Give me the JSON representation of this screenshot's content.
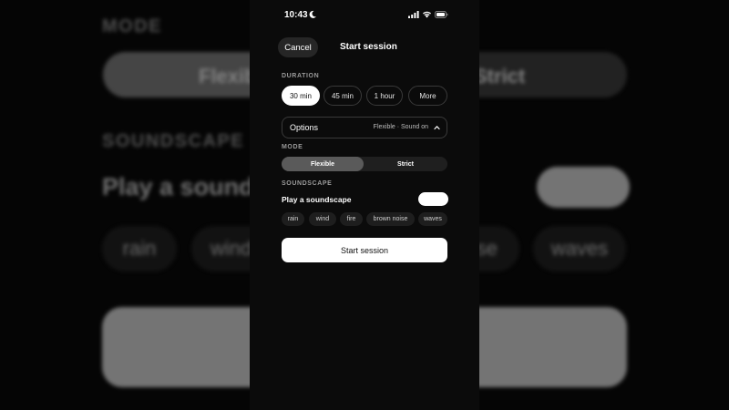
{
  "background": {
    "mode_label": "MODE",
    "mode_flexible": "Flexible",
    "mode_strict": "Strict",
    "soundscape_label": "SOUNDSCAPE",
    "play_label": "Play a sounds",
    "chips": [
      "rain",
      "wind",
      "se",
      "waves"
    ]
  },
  "status_bar": {
    "time": "10:43",
    "icons": [
      "moon-icon",
      "signal-icon",
      "wifi-icon",
      "battery-icon"
    ]
  },
  "nav": {
    "cancel_label": "Cancel",
    "title": "Start session"
  },
  "duration": {
    "label": "DURATION",
    "options": [
      "30 min",
      "45 min",
      "1 hour",
      "More"
    ],
    "selected": "30 min"
  },
  "options": {
    "label": "Options",
    "summary": "Flexible · Sound on",
    "icon": "chevron-up-icon"
  },
  "mode": {
    "label": "MODE",
    "options": [
      "Flexible",
      "Strict"
    ],
    "selected": "Flexible"
  },
  "soundscape": {
    "label": "SOUNDSCAPE",
    "play_label": "Play a soundscape",
    "toggle_on": true,
    "chips": [
      "rain",
      "wind",
      "fire",
      "brown noise",
      "waves"
    ]
  },
  "start_button": {
    "label": "Start session"
  },
  "colors": {
    "background": "#050505",
    "panel": "#0b0b0b",
    "accent": "#ffffff",
    "chip": "#1e1e1e",
    "muted_text": "#9a9a9a"
  }
}
